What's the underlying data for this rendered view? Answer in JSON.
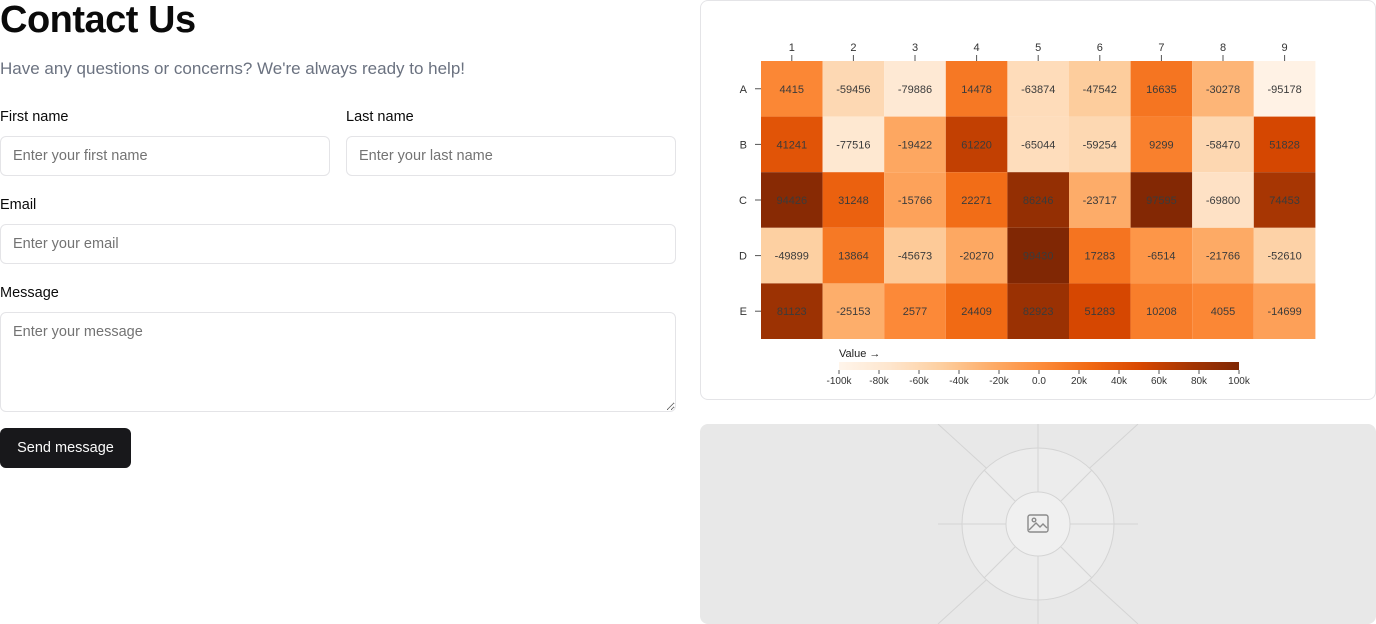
{
  "form": {
    "title": "Contact Us",
    "subtitle": "Have any questions or concerns? We're always ready to help!",
    "first_name": {
      "label": "First name",
      "placeholder": "Enter your first name",
      "value": ""
    },
    "last_name": {
      "label": "Last name",
      "placeholder": "Enter your last name",
      "value": ""
    },
    "email": {
      "label": "Email",
      "placeholder": "Enter your email",
      "value": ""
    },
    "message": {
      "label": "Message",
      "placeholder": "Enter your message",
      "value": ""
    },
    "submit_label": "Send message"
  },
  "chart_data": {
    "type": "heatmap",
    "columns": [
      "1",
      "2",
      "3",
      "4",
      "5",
      "6",
      "7",
      "8",
      "9"
    ],
    "rows": [
      "A",
      "B",
      "C",
      "D",
      "E"
    ],
    "values": [
      [
        4415,
        -59456,
        -79886,
        14478,
        -63874,
        -47542,
        16635,
        -30278,
        -95178
      ],
      [
        41241,
        -77516,
        -19422,
        61220,
        -65044,
        -59254,
        9299,
        -58470,
        51828
      ],
      [
        94426,
        31248,
        -15766,
        22271,
        86246,
        -23717,
        97595,
        -69800,
        74453
      ],
      [
        -49899,
        13864,
        -45673,
        -20270,
        99430,
        17283,
        -6514,
        -21766,
        -52610
      ],
      [
        81123,
        -25153,
        2577,
        24409,
        82923,
        51283,
        10208,
        4055,
        -14699
      ]
    ],
    "color_scale": {
      "min": -100000,
      "max": 100000,
      "low_color": "#fff5eb",
      "high_color": "#7f2704",
      "scheme": "oranges"
    },
    "legend": {
      "title": "Value →",
      "ticks": [
        "-100k",
        "-80k",
        "-60k",
        "-40k",
        "-20k",
        "0.0",
        "20k",
        "40k",
        "60k",
        "80k",
        "100k"
      ]
    }
  },
  "placeholder": {
    "icon": "image-icon"
  }
}
